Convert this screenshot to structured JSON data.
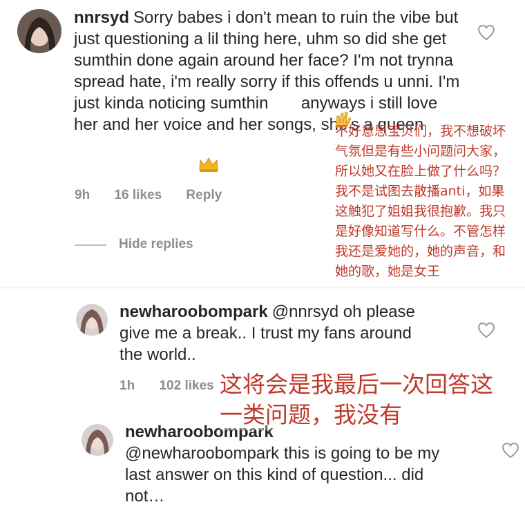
{
  "thread": {
    "comment": {
      "username": "nnrsyd",
      "text": "Sorry babes i don't mean to ruin the vibe but just questioning a lil thing here, uhm so did she get sumthin done again around her face? I'm not trynna spread hate, i'm really sorry if this offends u unni. I'm just kinda noticing sumthin",
      "text_after_emoji": "anyways i still love her and her voice and her songs, she's a queen",
      "time": "9h",
      "likes": "16 likes",
      "reply_label": "Reply"
    },
    "hide_replies_label": "Hide replies",
    "reply1": {
      "username": "newharoobompark",
      "text": "@nnrsyd oh please give me a break.. I trust my fans around the world..",
      "time": "1h",
      "likes": "102 likes"
    },
    "reply2": {
      "username": "newharoobompark",
      "text": "@newharoobompark this is going to be my last answer on this kind of question... did not…"
    }
  },
  "translations": {
    "top": "不好意思宝贝们，我不想破坏气氛但是有些小问题问大家，所以她又在脸上做了什么吗？我不是试图去散播anti，如果这触犯了姐姐我很抱歉。我只是好像知道写什么。不管怎样我还是爱她的，她的声音，和她的歌，她是女王",
    "bottom": "这将会是我最后一次回答这一类问题，我没有"
  },
  "icons": {
    "like": "heart-icon",
    "emoji_hands": "raising-hands-emoji",
    "emoji_crown": "crown-emoji"
  },
  "colors": {
    "text": "#262626",
    "meta": "#8e8e8e",
    "annotation": "#c0392b"
  }
}
